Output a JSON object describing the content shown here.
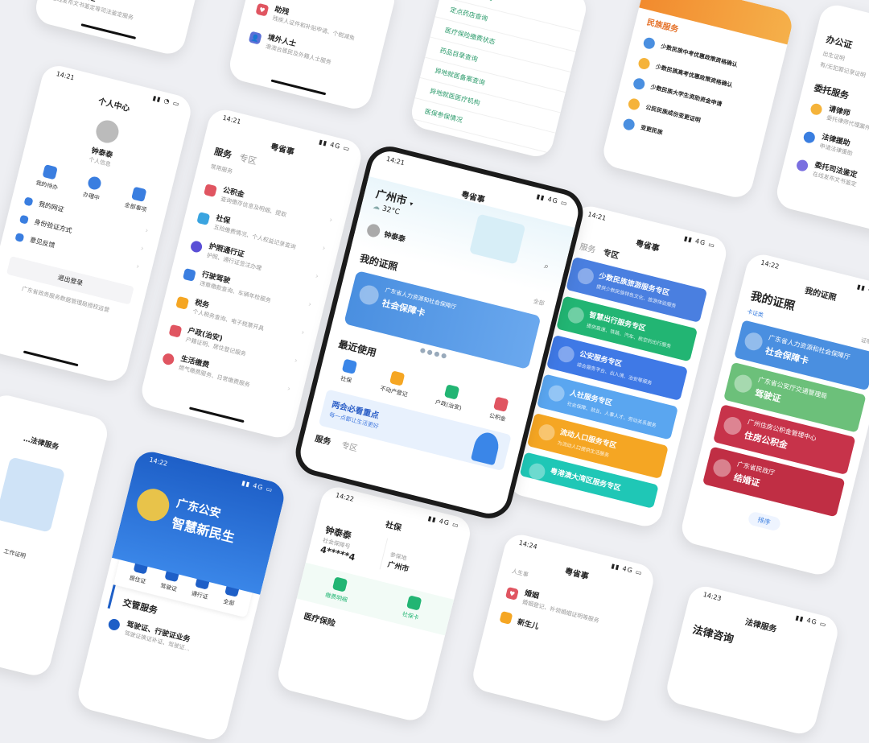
{
  "colors": {
    "blue": "#4a7fe0",
    "green": "#22b573",
    "orange": "#f5a623",
    "red": "#c7334a",
    "teal": "#1fc7b6",
    "lightblue": "#5aa6f0",
    "police": "#1e5fc7"
  },
  "p1": {
    "title": "…区司法鉴定",
    "sub": "在线发布文书鉴定等司法鉴定服务"
  },
  "p2": {
    "items": [
      {
        "label": "助残",
        "sub": "残疾人证件和补贴申请、个税减免"
      },
      {
        "label": "境外人士",
        "sub": "港澳台居民及外籍人士服务"
      }
    ]
  },
  "p3": {
    "links": [
      "定点医院查询",
      "定点药店查询",
      "医疗保险缴费状态",
      "药品目录查询",
      "异地就医备案查询",
      "异地就医医疗机构",
      "医保参保情况"
    ]
  },
  "p4": {
    "section": "民族服务",
    "items": [
      "少数民族中考优惠政策资格确认",
      "少数民族高考优惠政策资格确认",
      "少数民族大学生资助资金申请",
      "公民民族成份变更证明",
      "变更民族"
    ]
  },
  "p5": {
    "sections": [
      {
        "h": "办公证",
        "items": [
          "出生证明",
          "有/无犯罪记录证明"
        ]
      },
      {
        "h": "委托服务",
        "items": [
          "请律师",
          "法律援助",
          "委托司法鉴定"
        ]
      }
    ],
    "subs": [
      "委托律师代理案件",
      "申请法律援助",
      "在线发布文书鉴定"
    ]
  },
  "p6": {
    "time": "14:21",
    "title": "个人中心",
    "name": "钟泰泰",
    "tag": "个人信息",
    "actions": [
      "我的待办",
      "办理中",
      "全部事项"
    ],
    "menu": [
      "我的网证",
      "身份验证方式",
      "意见反馈"
    ],
    "logout": "退出登录",
    "note": "广东省政务服务数据管理局授权运营"
  },
  "p7": {
    "time": "14:21",
    "title": "粤省事",
    "tabs": [
      "服务",
      "专区"
    ],
    "section": "常用服务",
    "items": [
      {
        "label": "公积金",
        "sub": "查询缴存信息及明细、提取"
      },
      {
        "label": "社保",
        "sub": "五险缴费情况、个人权益记录查询"
      },
      {
        "label": "护照通行证",
        "sub": "护照、通行证签注办理"
      },
      {
        "label": "行驶驾驶",
        "sub": "违章缴款查询、车辆年检服务"
      },
      {
        "label": "税务",
        "sub": "个人税务查询、电子税票开具"
      },
      {
        "label": "户政(治安)",
        "sub": "户籍证明、居住登记服务"
      },
      {
        "label": "生活缴费",
        "sub": "燃气缴费服务、日常缴费服务"
      }
    ]
  },
  "p8": {
    "time": "14:21",
    "title": "粤省事",
    "city": "广州市",
    "temp": "32°C",
    "user": "钟泰泰",
    "certs_h": "我的证照",
    "all": "全部",
    "card_org": "广东省人力资源和社会保障厅",
    "card_name": "社会保障卡",
    "recent_h": "最近使用",
    "recent": [
      "社保",
      "不动产登记",
      "户政(治安)",
      "公积金"
    ],
    "banner_t": "两会必看重点",
    "banner_s": "每一点都让生活更好",
    "tabs": [
      "服务",
      "专区"
    ]
  },
  "p9": {
    "time": "14:21",
    "title": "粤省事",
    "tabs": [
      "服务",
      "专区"
    ],
    "zones": [
      {
        "t": "少数民族旅游服务专区",
        "s": "提供少数民族特色文化、旅游体验服务"
      },
      {
        "t": "智慧出行服务专区",
        "s": "提供高速、铁路、汽车、航空的出行服务"
      },
      {
        "t": "公安服务专区",
        "s": "综合服务平台、出入境、治安等服务"
      },
      {
        "t": "人社服务专区",
        "s": "社会保障、就业、人事人才、劳动关系服务"
      },
      {
        "t": "流动人口服务专区",
        "s": "为流动人口提供生活服务"
      },
      {
        "t": "粤港澳大湾区服务专区",
        "s": ""
      }
    ]
  },
  "p10": {
    "time": "14:22",
    "title": "我的证照",
    "big": "我的证照",
    "tab": "卡证类",
    "more": "证明类",
    "cards": [
      {
        "org": "广东省人力资源和社会保障厅",
        "n": "社会保障卡"
      },
      {
        "org": "广东省公安厅交通管理局",
        "n": "驾驶证"
      },
      {
        "org": "广州住房公积金管理中心",
        "n": "住房公积金"
      },
      {
        "org": "广东省民政厅",
        "n": "结婚证"
      }
    ],
    "sort": "排序"
  },
  "p11": {
    "title": "…法律服务",
    "items": [
      "工作证明"
    ]
  },
  "p12": {
    "time": "14:22",
    "headline1": "广东公安",
    "headline2": "智慧新民生",
    "icons": [
      "居住证",
      "驾驶证",
      "通行证",
      "全部"
    ],
    "section": "交管服务",
    "row": "驾驶证、行驶证业务",
    "row_s": "驾驶证换证补证、驾驶证…"
  },
  "p13": {
    "time": "14:22",
    "title": "社保",
    "name": "钟泰泰",
    "num_label": "社会保障号",
    "num": "4*****4",
    "city_label": "参保地",
    "city": "广州市",
    "btns": [
      "缴费明细",
      "社保卡"
    ],
    "section": "医疗保险"
  },
  "p14": {
    "time": "14:24",
    "title": "粤省事",
    "tag": "人生事",
    "items": [
      {
        "label": "婚姻",
        "sub": "婚姻登记、补领婚姻证明等服务"
      },
      {
        "label": "新生儿",
        "sub": ""
      }
    ]
  },
  "p15": {
    "time": "14:23",
    "title": "法律服务",
    "big": "法律咨询"
  }
}
